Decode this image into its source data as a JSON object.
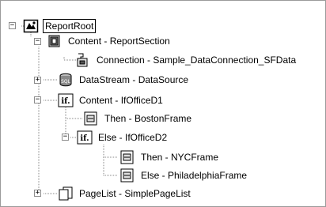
{
  "tree": {
    "root": {
      "label": "ReportRoot",
      "icon": "report-root-icon",
      "expander": "−"
    },
    "content_section": {
      "label": "Content - ReportSection",
      "icon": "report-section-icon",
      "expander": "−"
    },
    "connection": {
      "label": "Connection - Sample_DataConnection_SFData",
      "icon": "data-connection-icon"
    },
    "datastream": {
      "label": "DataStream - DataSource",
      "icon": "datastream-icon",
      "expander": "+"
    },
    "if1": {
      "label": "Content - IfOfficeD1",
      "icon": "if-icon",
      "expander": "−"
    },
    "then1": {
      "label": "Then - BostonFrame",
      "icon": "frame-icon"
    },
    "else1": {
      "label": "Else - IfOfficeD2",
      "icon": "if-icon",
      "expander": "−"
    },
    "then2": {
      "label": "Then - NYCFrame",
      "icon": "frame-icon"
    },
    "else2": {
      "label": "Else - PhiladelphiaFrame",
      "icon": "frame-icon"
    },
    "pagelist": {
      "label": "PageList - SimplePageList",
      "icon": "pagelist-icon",
      "expander": "+"
    }
  },
  "colors": {
    "line": "#9a9a9a",
    "selection_border": "#000000"
  }
}
